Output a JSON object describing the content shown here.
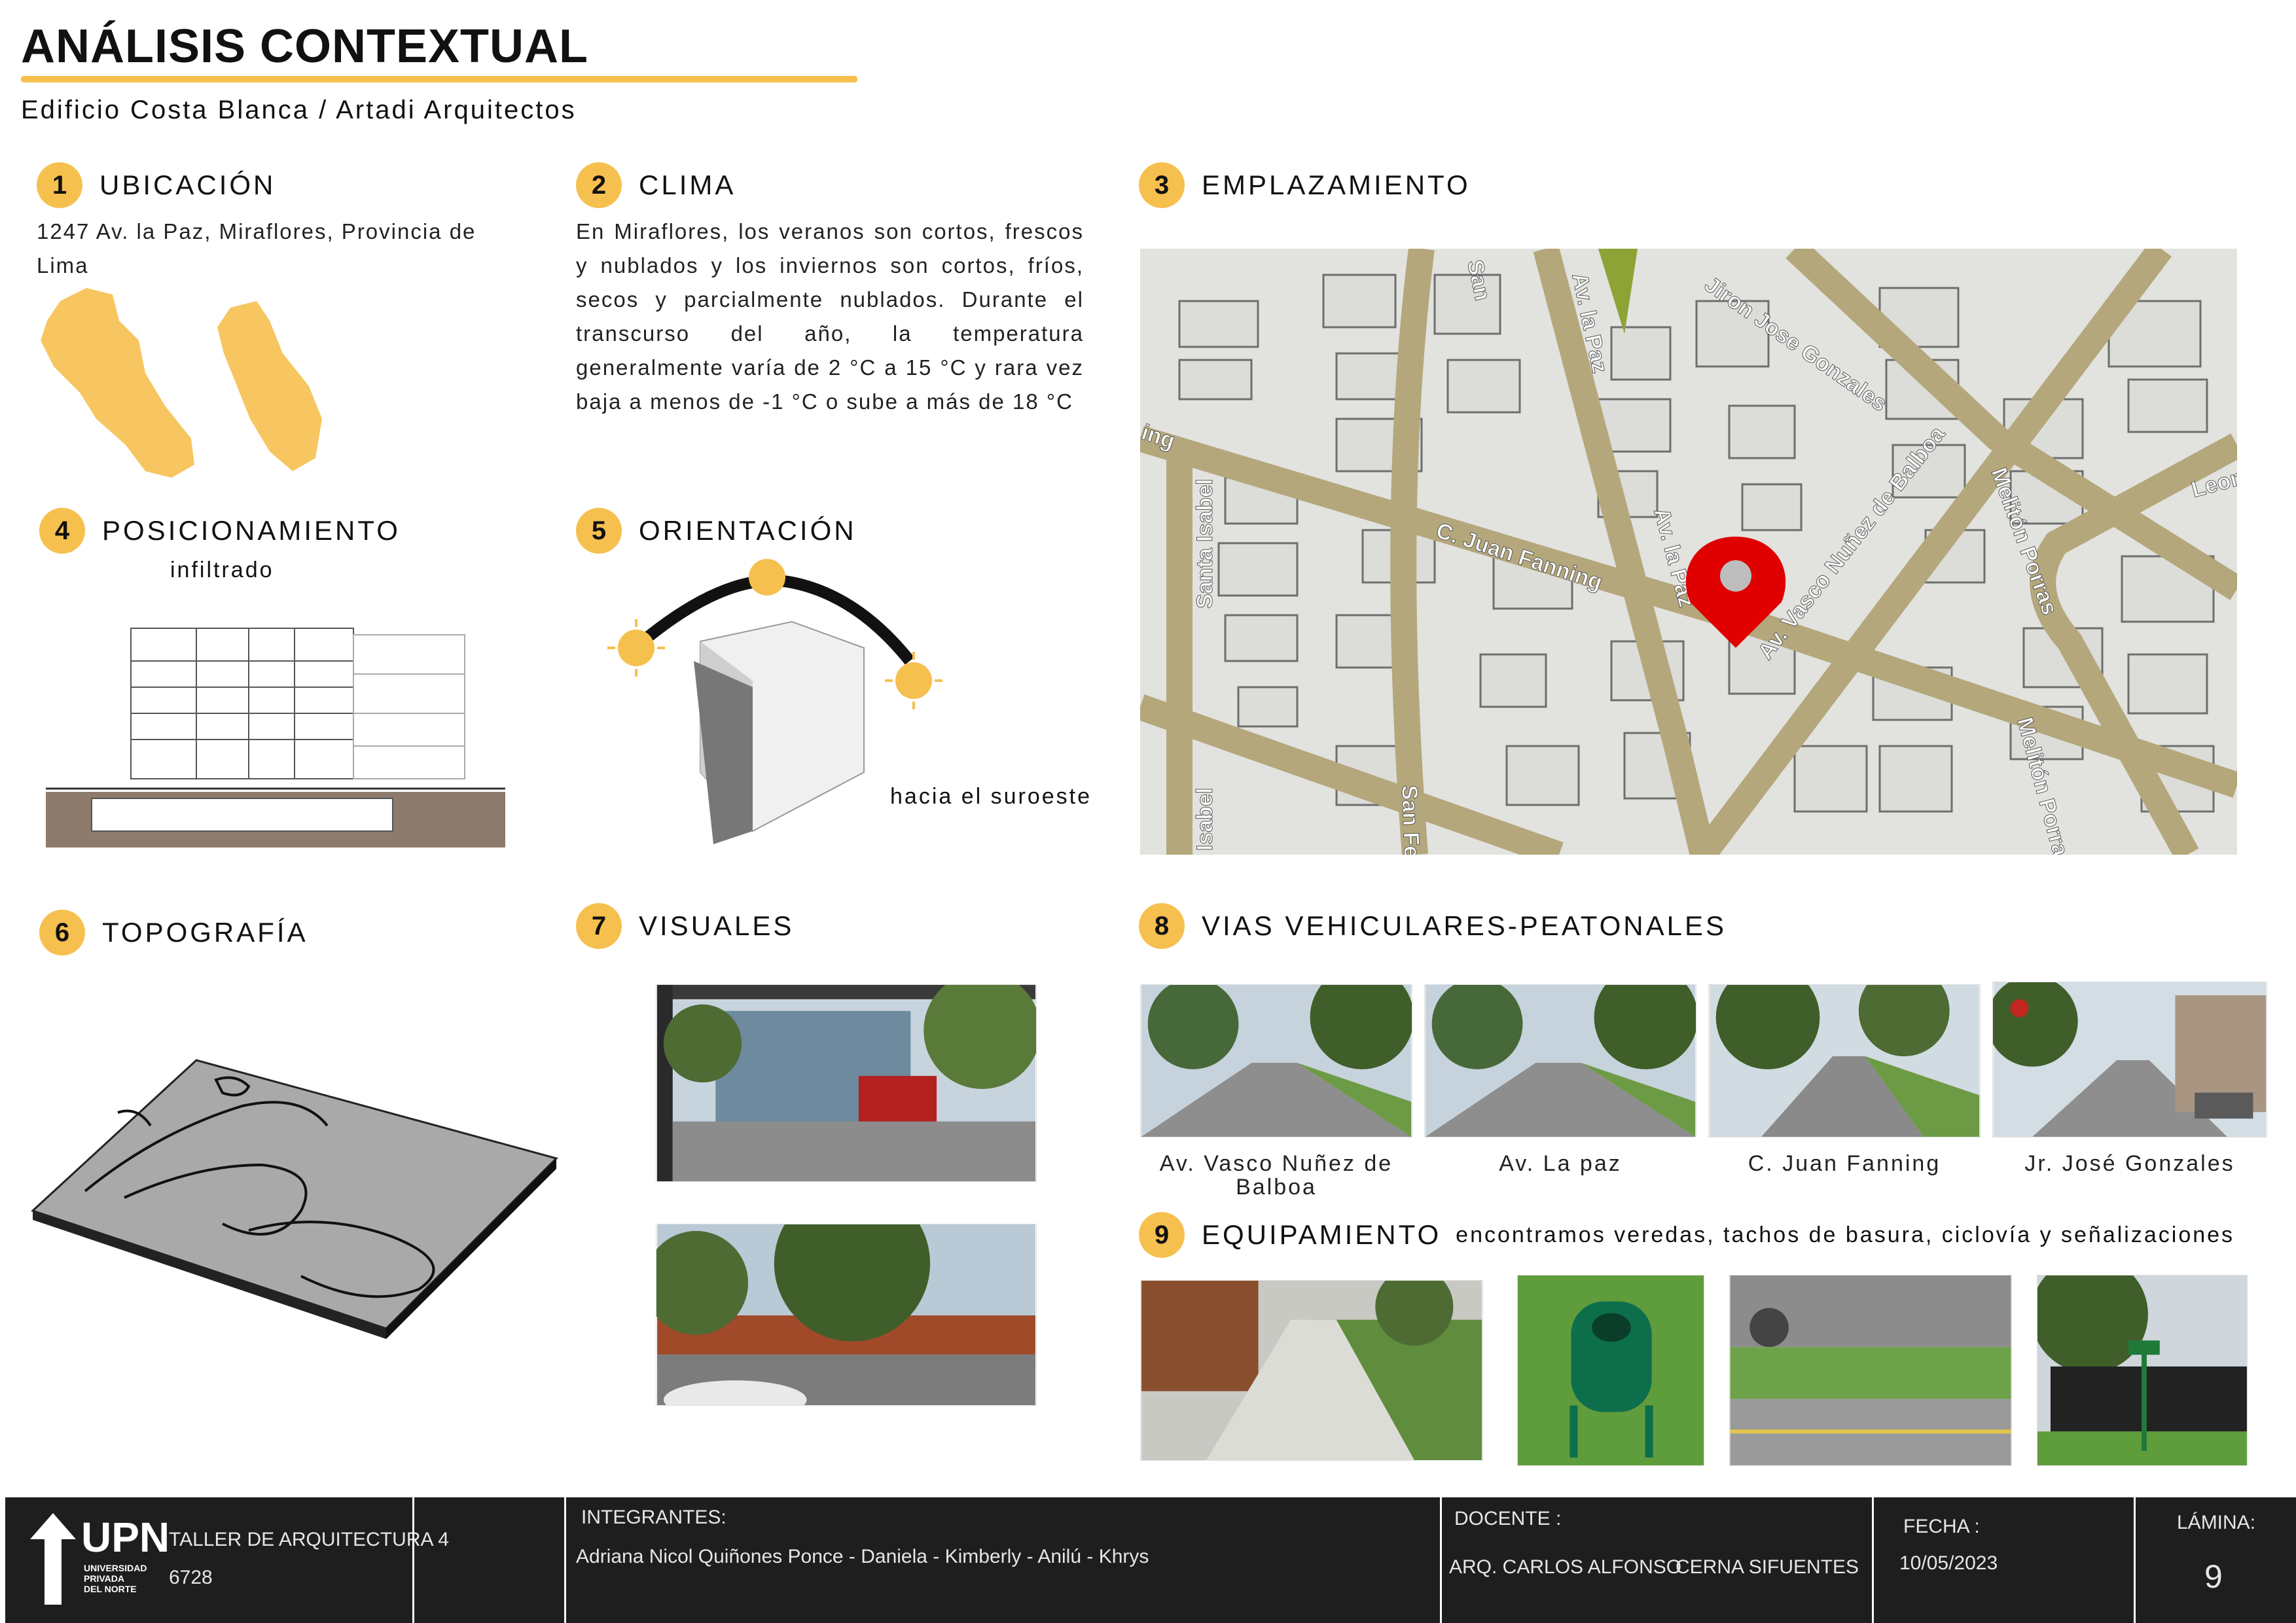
{
  "header": {
    "title": "ANÁLISIS CONTEXTUAL",
    "subtitle": "Edificio Costa Blanca / Artadi Arquitectos"
  },
  "colors": {
    "accent": "#f6c04f",
    "road": "#b4a77b",
    "block": "#d8d8d5",
    "pin": "#e00000",
    "footer": "#1e1e1e"
  },
  "sections": {
    "ubicacion": {
      "number": "1",
      "title": "UBICACIÓN",
      "text": "1247 Av. la Paz, Miraflores, Provincia de Lima"
    },
    "clima": {
      "number": "2",
      "title": "CLIMA",
      "text": "En Miraflores, los veranos son cortos, frescos y nublados y los inviernos son cortos, fríos, secos y parcialmente nublados. Durante el transcurso del año, la temperatura generalmente varía de 2 °C a 15 °C y rara vez baja a menos de -1 °C o sube a más de 18 °C"
    },
    "emplazamiento": {
      "number": "3",
      "title": "EMPLAZAMIENTO",
      "streets": [
        "Jiron Jose Gonzales",
        "Av. la Paz",
        "Av. la Paz",
        "C. Juan Fanning",
        "Av. Vasco Nuñez de Balboa",
        "Santa Isabel",
        "Melitón Porras",
        "Melitón Porras",
        "San Fe",
        "Isabel",
        "ing",
        "Leon",
        "San"
      ],
      "icon": "map-pin-icon"
    },
    "posicionamiento": {
      "number": "4",
      "title": "POSICIONAMIENTO",
      "subtitle": "infiltrado"
    },
    "orientacion": {
      "number": "5",
      "title": "ORIENTACIÓN",
      "caption": "hacia el suroeste",
      "icon": "sun-icon"
    },
    "topografia": {
      "number": "6",
      "title": "TOPOGRAFÍA"
    },
    "visuales": {
      "number": "7",
      "title": "VISUALES"
    },
    "vias": {
      "number": "8",
      "title": "VIAS VEHICULARES-PEATONALES",
      "photos": [
        "Av. Vasco Nuñez de Balboa",
        "Av. La paz",
        "C. Juan Fanning",
        "Jr. José Gonzales"
      ]
    },
    "equipamiento": {
      "number": "9",
      "title": "EQUIPAMIENTO",
      "text": "encontramos veredas, tachos de basura, ciclovía y señalizaciones"
    }
  },
  "footer": {
    "logo_text": "UPN",
    "university": [
      "UNIVERSIDAD",
      "PRIVADA",
      "DEL NORTE"
    ],
    "course": "TALLER DE ARQUITECTURA  4",
    "code": "6728",
    "members_label": "INTEGRANTES:",
    "members": "Adriana Nicol Quiñones Ponce - Daniela - Kimberly - Anilú - Khrys",
    "teacher_label": "DOCENTE :",
    "teacher_name": "ARQ. CARLOS ALFONSO",
    "teacher_surname": "CERNA SIFUENTES",
    "date_label": "FECHA :",
    "date": "10/05/2023",
    "sheet_label": "LÁMINA:",
    "sheet": "9"
  }
}
